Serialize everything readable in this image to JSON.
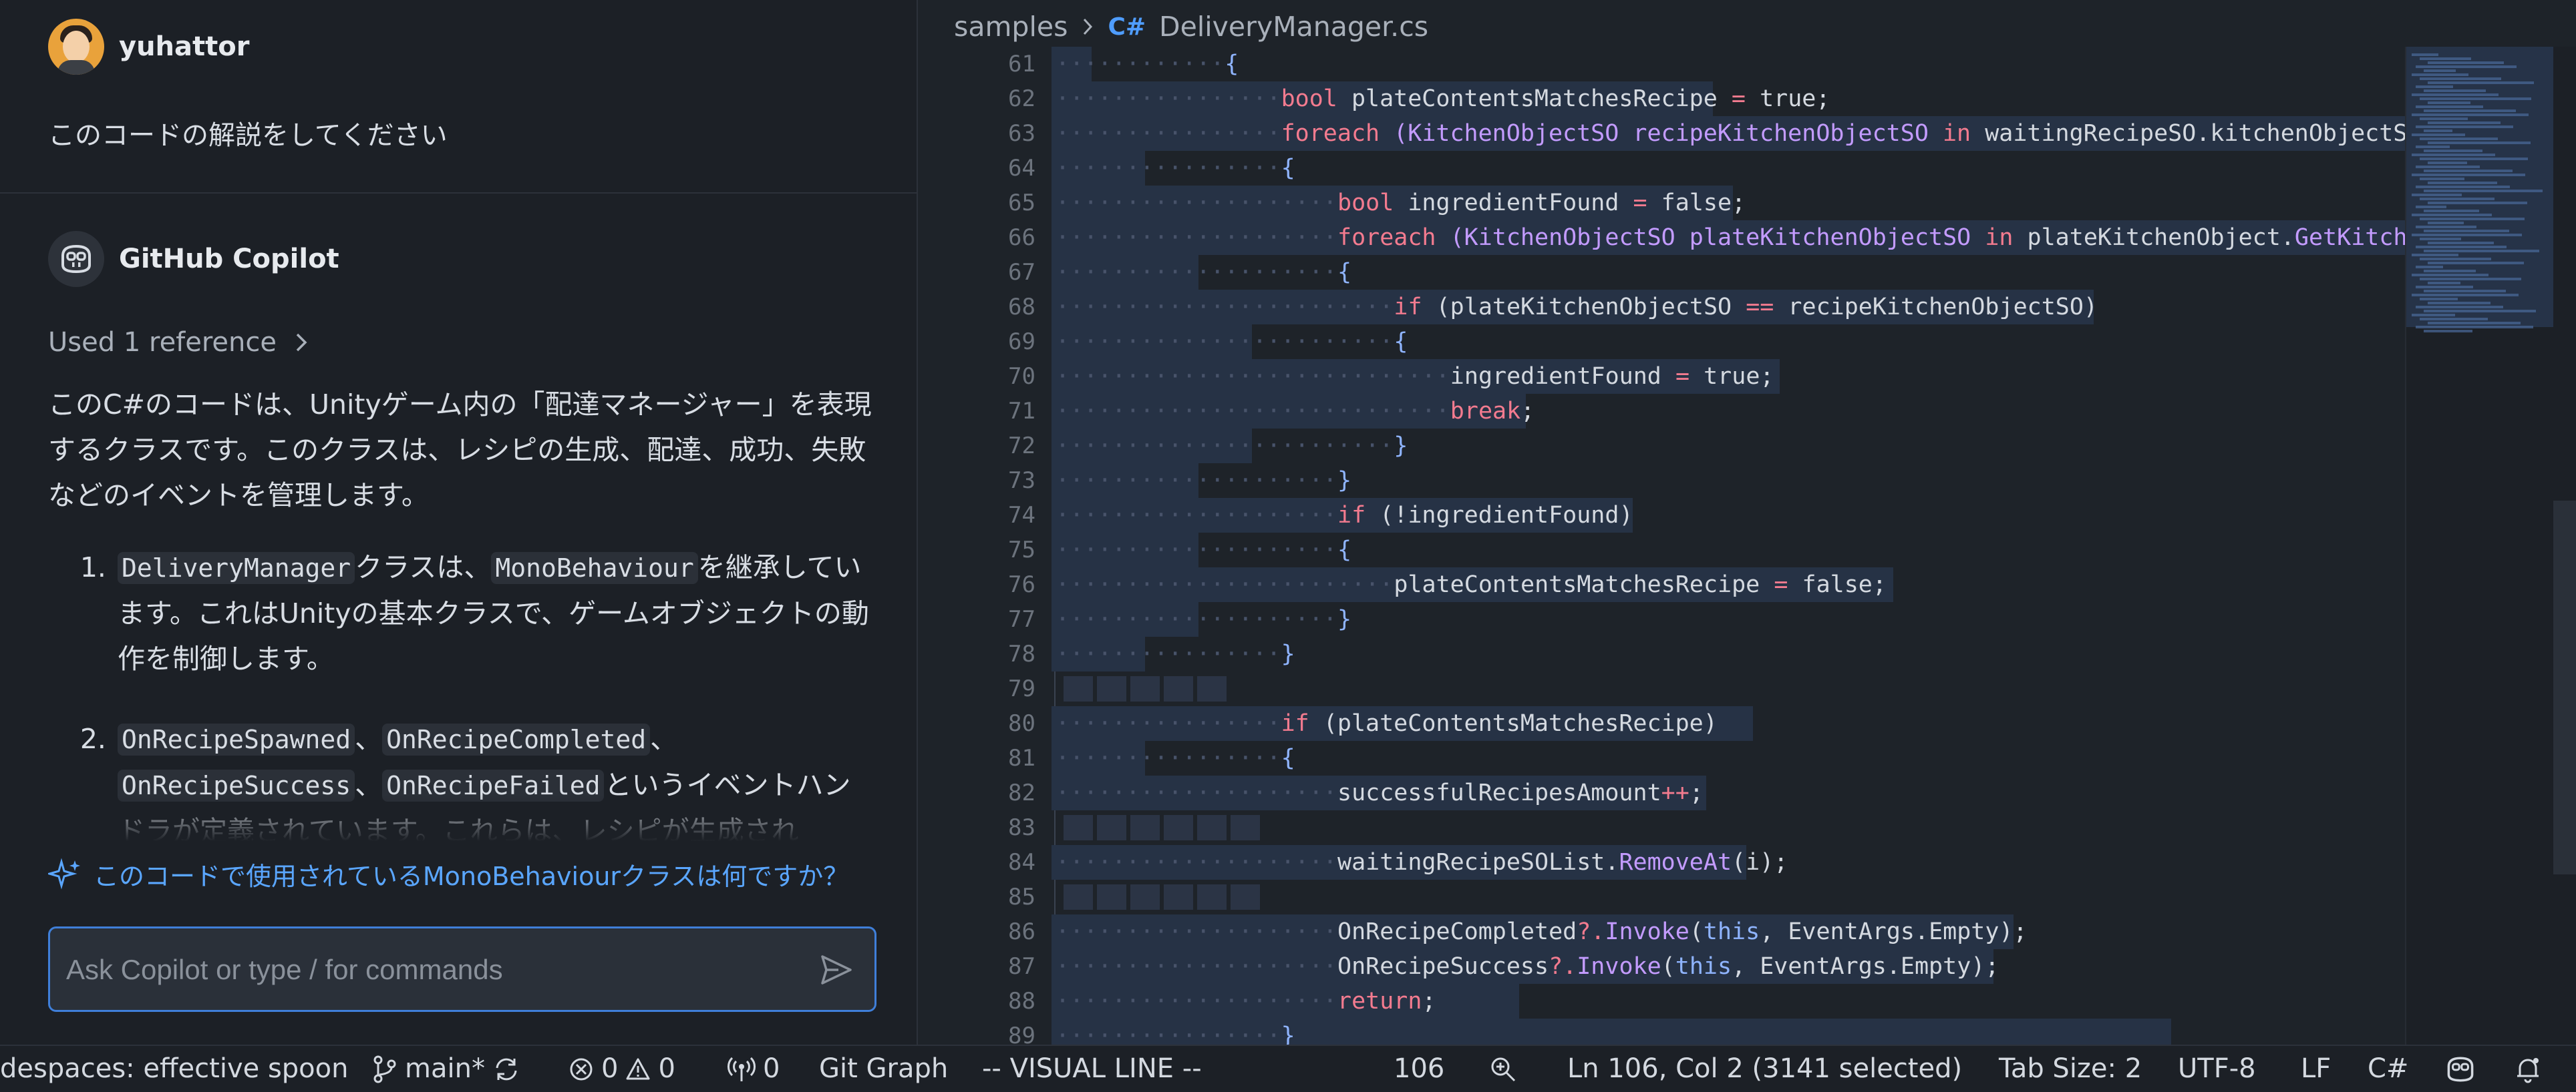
{
  "chat": {
    "user": {
      "name": "yuhattor",
      "message": "このコードの解説をしてください"
    },
    "assistant": {
      "name": "GitHub Copilot",
      "used_reference": "Used 1 reference",
      "intro": "このC#のコードは、Unityゲーム内の「配達マネージャー」を表現するクラスです。このクラスは、レシピの生成、配達、成功、失敗などのイベントを管理します。",
      "items": [
        {
          "code1": "DeliveryManager",
          "t1": "クラスは、",
          "code2": "MonoBehaviour",
          "t2": "を継承しています。これはUnityの基本クラスで、ゲームオブジェクトの動作を制御します。"
        },
        {
          "c1": "OnRecipeSpawned",
          "c2": "OnRecipeCompleted",
          "c3": "OnRecipeSuccess",
          "c4": "OnRecipeFailed",
          "t1": "、",
          "t2": "、",
          "t3": "、",
          "t4": "というイベントハンドラが定義されています。これらは、レシピが生成され"
        }
      ]
    },
    "suggestion": "このコードで使用されているMonoBehaviourクラスは何ですか？",
    "input_placeholder": "Ask Copilot or type / for commands"
  },
  "editor": {
    "breadcrumb": [
      "samples",
      "DeliveryManager.cs"
    ],
    "file_icon": "C#",
    "lines": [
      {
        "n": "61",
        "ind": 3,
        "sel": 260,
        "t": [
          [
            "{",
            "kb"
          ]
        ]
      },
      {
        "n": "62",
        "ind": 4,
        "sel": 1190,
        "t": [
          [
            "bool ",
            "k"
          ],
          [
            "plateContentsMatchesRecipe ",
            ""
          ],
          [
            "= ",
            "k"
          ],
          [
            "true",
            ""
          ],
          [
            ";",
            ""
          ]
        ]
      },
      {
        "n": "63",
        "ind": 4,
        "sel": 2226,
        "t": [
          [
            "foreach ",
            "k"
          ],
          [
            "(KitchenObjectSO recipeKitchenObjectSO ",
            "fn"
          ],
          [
            "in ",
            "k"
          ],
          [
            "waitingRecipeSO.kitchenObjectSO",
            ""
          ]
        ]
      },
      {
        "n": "64",
        "ind": 4,
        "sel": 340,
        "t": [
          [
            "{",
            "kb"
          ]
        ]
      },
      {
        "n": "65",
        "ind": 5,
        "sel": 1220,
        "t": [
          [
            "bool ",
            "k"
          ],
          [
            "ingredientFound ",
            ""
          ],
          [
            "= ",
            "k"
          ],
          [
            "false",
            ""
          ],
          [
            ";",
            ""
          ]
        ]
      },
      {
        "n": "66",
        "ind": 5,
        "sel": 2226,
        "t": [
          [
            "foreach ",
            "k"
          ],
          [
            "(KitchenObjectSO plateKitchenObjectSO ",
            "fn"
          ],
          [
            "in ",
            "k"
          ],
          [
            "plateKitchenObject.",
            ""
          ],
          [
            "GetKitche",
            "fn"
          ]
        ]
      },
      {
        "n": "67",
        "ind": 5,
        "sel": 420,
        "t": [
          [
            "{",
            "kb"
          ]
        ]
      },
      {
        "n": "68",
        "ind": 6,
        "sel": 1760,
        "t": [
          [
            "if ",
            "k"
          ],
          [
            "(plateKitchenObjectSO ",
            ""
          ],
          [
            "== ",
            "k"
          ],
          [
            "recipeKitchenObjectSO)",
            ""
          ]
        ]
      },
      {
        "n": "69",
        "ind": 6,
        "sel": 500,
        "t": [
          [
            "{",
            "kb"
          ]
        ]
      },
      {
        "n": "70",
        "ind": 7,
        "sel": 1290,
        "t": [
          [
            "ingredientFound ",
            ""
          ],
          [
            "= ",
            "k"
          ],
          [
            "true",
            ""
          ],
          [
            ";",
            ""
          ]
        ]
      },
      {
        "n": "71",
        "ind": 7,
        "sel": 910,
        "t": [
          [
            "break",
            "k"
          ],
          [
            ";",
            ""
          ]
        ]
      },
      {
        "n": "72",
        "ind": 6,
        "sel": 500,
        "t": [
          [
            "}",
            "kb"
          ]
        ]
      },
      {
        "n": "73",
        "ind": 5,
        "sel": 420,
        "t": [
          [
            "}",
            "kb"
          ]
        ]
      },
      {
        "n": "74",
        "ind": 5,
        "sel": 1070,
        "t": [
          [
            "if ",
            "k"
          ],
          [
            "(!ingredientFound)",
            ""
          ]
        ]
      },
      {
        "n": "75",
        "ind": 5,
        "sel": 420,
        "t": [
          [
            "{",
            "kb"
          ]
        ]
      },
      {
        "n": "76",
        "ind": 6,
        "sel": 1460,
        "t": [
          [
            "plateContentsMatchesRecipe ",
            ""
          ],
          [
            "= ",
            "k"
          ],
          [
            "false",
            ""
          ],
          [
            ";",
            ""
          ]
        ]
      },
      {
        "n": "77",
        "ind": 5,
        "sel": 420,
        "t": [
          [
            "}",
            "kb"
          ]
        ]
      },
      {
        "n": "78",
        "ind": 4,
        "sel": 340,
        "t": [
          [
            "}",
            "kb"
          ]
        ]
      },
      {
        "n": "79",
        "ind": 0,
        "sel": 0,
        "blocks": 5,
        "t": []
      },
      {
        "n": "80",
        "ind": 4,
        "sel": 1250,
        "t": [
          [
            "if ",
            "k"
          ],
          [
            "(plateContentsMatchesRecipe)",
            ""
          ]
        ]
      },
      {
        "n": "81",
        "ind": 4,
        "sel": 340,
        "t": [
          [
            "{",
            "kb"
          ]
        ]
      },
      {
        "n": "82",
        "ind": 5,
        "sel": 1180,
        "t": [
          [
            "successfulRecipesAmount",
            ""
          ],
          [
            "++",
            "k"
          ],
          [
            ";",
            ""
          ]
        ]
      },
      {
        "n": "83",
        "ind": 0,
        "sel": 0,
        "blocks": 6,
        "t": []
      },
      {
        "n": "84",
        "ind": 5,
        "sel": 1240,
        "t": [
          [
            "waitingRecipeSOList.",
            ""
          ],
          [
            "RemoveAt",
            "fn"
          ],
          [
            "(i);",
            ""
          ]
        ]
      },
      {
        "n": "85",
        "ind": 0,
        "sel": 0,
        "blocks": 6,
        "t": []
      },
      {
        "n": "86",
        "ind": 5,
        "sel": 1640,
        "t": [
          [
            "OnRecipeCompleted",
            ""
          ],
          [
            "?.",
            "k"
          ],
          [
            "Invoke",
            "fn"
          ],
          [
            "(",
            ""
          ],
          [
            "this",
            "kb"
          ],
          [
            ", EventArgs.Empty);",
            ""
          ]
        ]
      },
      {
        "n": "87",
        "ind": 5,
        "sel": 1610,
        "t": [
          [
            "OnRecipeSuccess",
            ""
          ],
          [
            "?.",
            "k"
          ],
          [
            "Invoke",
            "fn"
          ],
          [
            "(",
            ""
          ],
          [
            "this",
            "kb"
          ],
          [
            ", EventArgs.Empty);",
            ""
          ]
        ]
      },
      {
        "n": "88",
        "ind": 5,
        "sel": 900,
        "t": [
          [
            "return",
            "k"
          ],
          [
            ";",
            ""
          ]
        ]
      },
      {
        "n": "89",
        "ind": 4,
        "sel": 1876,
        "t": [
          [
            "}",
            "kb"
          ]
        ]
      }
    ]
  },
  "status": {
    "codespaces": "despaces: effective spoon",
    "branch": "main*",
    "errors": "0",
    "warnings": "0",
    "ports": "0",
    "git_graph": "Git Graph",
    "mode": "-- VISUAL LINE --",
    "line_count": "106",
    "position": "Ln 106, Col 2 (3141 selected)",
    "tab_size": "Tab Size: 2",
    "encoding": "UTF-8",
    "eol": "LF",
    "language": "C#"
  }
}
